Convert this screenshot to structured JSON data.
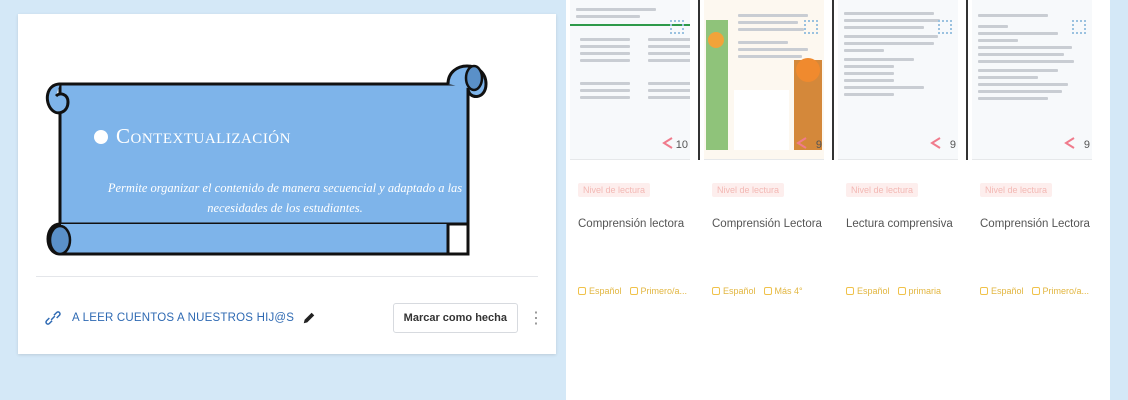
{
  "lesson_panel": {
    "banner_title": "Contextualización",
    "banner_description": "Permite organizar el contenido de manera secuencial y adaptado a las necesidades de los estudiantes.",
    "lesson_link_text": "A LEER CUENTOS A NUESTROS HIJ@S",
    "mark_done_label": "Marcar como hecha",
    "menu_glyph": "⋮"
  },
  "resources": [
    {
      "level": "Nivel de lectura",
      "title": "Comprensión lectora",
      "subject": "Español",
      "grade": "Primero/a...",
      "shares": "10"
    },
    {
      "level": "Nivel de lectura",
      "title": "Comprensión Lectora",
      "subject": "Español",
      "grade": "Más 4°",
      "shares": "9"
    },
    {
      "level": "Nivel de lectura",
      "title": "Lectura comprensiva",
      "subject": "Español",
      "grade": "primaria",
      "shares": "9"
    },
    {
      "level": "Nivel de lectura",
      "title": "Comprensión Lectora",
      "subject": "Español",
      "grade": "Primero/a...",
      "shares": "9"
    }
  ],
  "colors": {
    "banner_fill": "#7eb4ea",
    "link_blue": "#2f6ab3",
    "badge_pink": "#f3b8b4",
    "meta_yellow": "#e2b640",
    "share_pink": "#f07b8c"
  }
}
